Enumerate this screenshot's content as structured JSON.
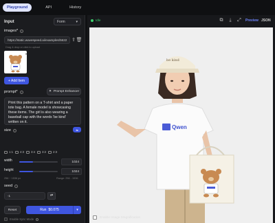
{
  "tabs": [
    {
      "label": "Playground",
      "active": true
    },
    {
      "label": "API",
      "active": false
    },
    {
      "label": "History",
      "active": false
    }
  ],
  "input_panel": {
    "title": "Input",
    "mode_select": "Form",
    "images_label": "images*",
    "image_url": "https://static.wavespeed.ai/examples/56225r",
    "drop_hint": "Drag & drop or click to upload",
    "add_item": "+ Add Item",
    "prompt_label": "prompt*",
    "prompt_enhancer": "Prompt Enhancer",
    "prompt_text": "Print this pattern on a T-shirt and a paper tote bag. A female model is showcasing these items. The girl is also wearing a baseball cap with the words 'be kind' written on it.",
    "size_label": "size",
    "ratios": [
      "1:1",
      "4:3",
      "3:4",
      "3:2",
      "2:3"
    ],
    "width_label": "width",
    "width_value": "1024",
    "width_fraction": 0.35,
    "height_label": "height",
    "height_value": "1024",
    "height_fraction": 0.35,
    "size_range_hint": "256 ~ 1536 px",
    "size_range_right": "Range: 256 - 1536",
    "seed_label": "seed",
    "seed_value": "-1",
    "reset_label": "Reset",
    "run_label": "Run",
    "run_price": "$0.075",
    "sync_label": "Enable Sync Mode"
  },
  "output_panel": {
    "status": "Idle",
    "tab_preview": "Preview",
    "tab_json": "JSON",
    "cap_text": "be kind",
    "shirt_brand": "Qwen",
    "enable_magnification": "Enable Image Magnification"
  },
  "colors": {
    "accent": "#3f56e0",
    "active_tab_bg": "#dfe4ff",
    "status_green": "#3ccf6e"
  }
}
